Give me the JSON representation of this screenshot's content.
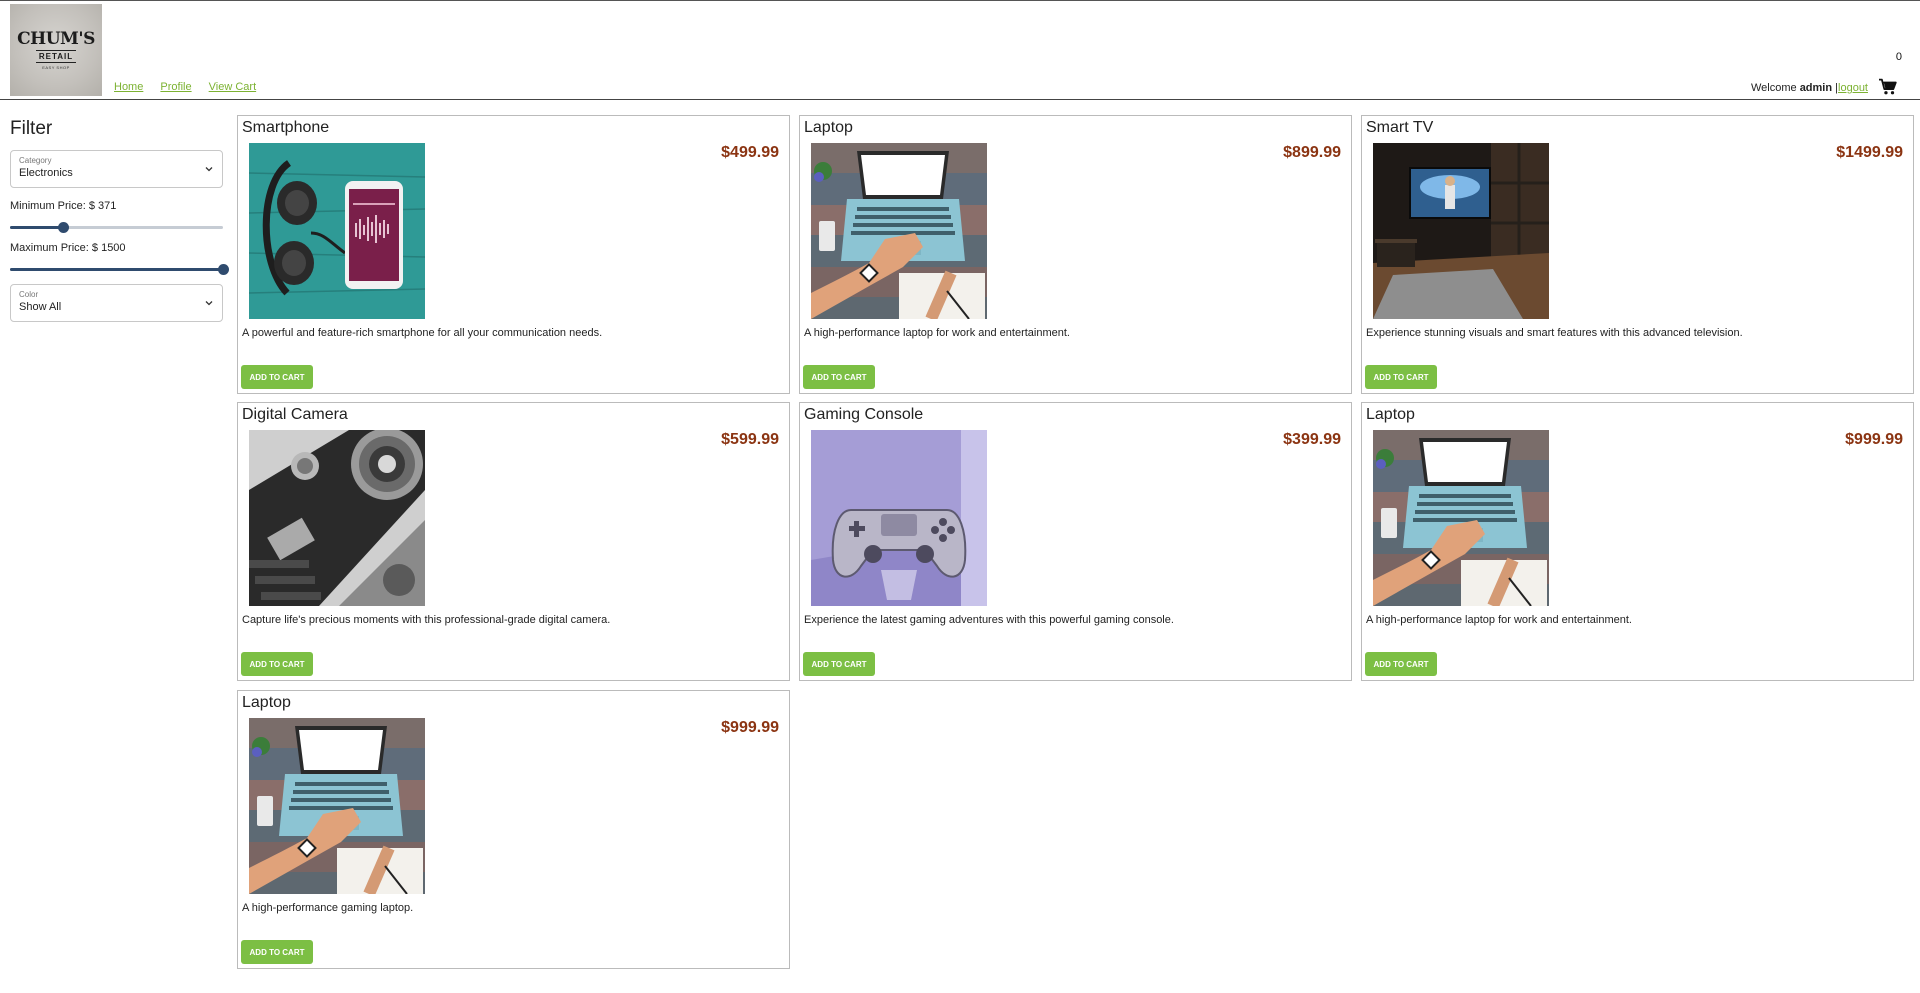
{
  "brand": {
    "line1": "CHUM'S",
    "line2": "RETAIL",
    "line3": "EASY SHOP"
  },
  "nav": {
    "home": "Home",
    "profile": "Profile",
    "view_cart": "View Cart"
  },
  "user": {
    "welcome": "Welcome",
    "name": "admin",
    "separator": "|",
    "logout": "logout",
    "cart_count": "0"
  },
  "filter": {
    "title": "Filter",
    "category": {
      "label": "Category",
      "value": "Electronics"
    },
    "min_price": {
      "label": "Minimum Price: $ 371",
      "fraction": 0.247
    },
    "max_price": {
      "label": "Maximum Price: $ 1500",
      "fraction": 1.0
    },
    "color": {
      "label": "Color",
      "value": "Show All"
    }
  },
  "products": [
    {
      "name": "Smartphone",
      "price": "$499.99",
      "description": "A powerful and feature-rich smartphone for all your communication needs.",
      "button": "ADD TO CART",
      "image": "smartphone"
    },
    {
      "name": "Laptop",
      "price": "$899.99",
      "description": "A high-performance laptop for work and entertainment.",
      "button": "ADD TO CART",
      "image": "laptop"
    },
    {
      "name": "Smart TV",
      "price": "$1499.99",
      "description": "Experience stunning visuals and smart features with this advanced television.",
      "button": "ADD TO CART",
      "image": "tv"
    },
    {
      "name": "Digital Camera",
      "price": "$599.99",
      "description": "Capture life's precious moments with this professional-grade digital camera.",
      "button": "ADD TO CART",
      "image": "camera"
    },
    {
      "name": "Gaming Console",
      "price": "$399.99",
      "description": "Experience the latest gaming adventures with this powerful gaming console.",
      "button": "ADD TO CART",
      "image": "console"
    },
    {
      "name": "Laptop",
      "price": "$999.99",
      "description": "A high-performance laptop for work and entertainment.",
      "button": "ADD TO CART",
      "image": "laptop"
    },
    {
      "name": "Laptop",
      "price": "$999.99",
      "description": "A high-performance gaming laptop.",
      "button": "ADD TO CART",
      "image": "laptop"
    }
  ],
  "icons": {
    "cart": "shopping-cart-icon",
    "dropdown": "chevron-down-icon"
  },
  "colors": {
    "accent_green": "#7cbf44",
    "link_green": "#7cb232",
    "price": "#8b3412",
    "slider": "#2f4b6e"
  }
}
